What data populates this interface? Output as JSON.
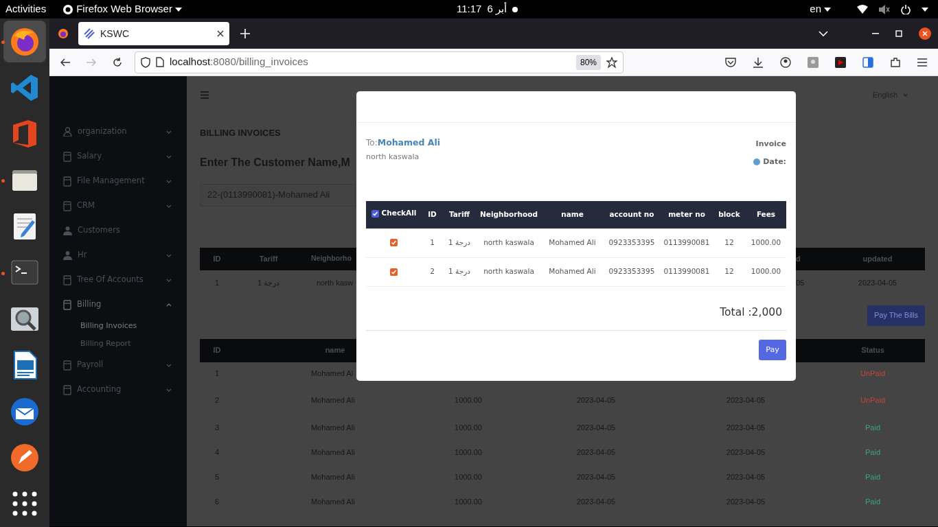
{
  "desktop": {
    "activities": "Activities",
    "app_menu": "Firefox Web Browser",
    "clock": {
      "time": "11:17",
      "date": "أبر 6"
    },
    "keyboard": "en"
  },
  "dock": [
    {
      "kind": "browser",
      "running": true,
      "selected": true
    },
    {
      "kind": "code",
      "running": false,
      "selected": false
    },
    {
      "kind": "office",
      "running": false,
      "selected": false
    },
    {
      "kind": "files",
      "running": true,
      "selected": false
    },
    {
      "kind": "editor",
      "running": false,
      "selected": false
    },
    {
      "kind": "terminal",
      "running": true,
      "selected": false
    },
    {
      "kind": "viewer",
      "running": false,
      "selected": false
    },
    {
      "kind": "writer",
      "running": false,
      "selected": false
    },
    {
      "kind": "mail",
      "running": false,
      "selected": false
    },
    {
      "kind": "api",
      "running": false,
      "selected": false
    },
    {
      "kind": "apps",
      "running": false,
      "selected": false
    }
  ],
  "browser": {
    "tab": {
      "title": "KSWC"
    },
    "url": {
      "host": "localhost",
      "path": ":8080/billing_invoices"
    },
    "zoom": "80%"
  },
  "sidebar": {
    "items": [
      {
        "label": "organization",
        "kind": "menu",
        "expanded": false
      },
      {
        "label": "Salary",
        "kind": "menu",
        "expanded": false
      },
      {
        "label": "File Management",
        "kind": "menu",
        "expanded": false
      },
      {
        "label": "CRM",
        "kind": "menu",
        "expanded": false
      },
      {
        "label": "Customers",
        "kind": "link"
      },
      {
        "label": "Hr",
        "kind": "menu",
        "expanded": false
      },
      {
        "label": "Tree Of Accounts",
        "kind": "menu",
        "expanded": false
      },
      {
        "label": "Billing",
        "kind": "menu",
        "expanded": true,
        "children": [
          {
            "label": "Billing Invoices",
            "selected": true
          },
          {
            "label": "Billing Report",
            "selected": false
          }
        ]
      },
      {
        "label": "Payroll",
        "kind": "menu",
        "expanded": false
      },
      {
        "label": "Accounting",
        "kind": "menu",
        "expanded": false
      }
    ]
  },
  "header": {
    "language": "English"
  },
  "page": {
    "title": "BILLING INVOICES",
    "prompt": "Enter The Customer Name,M",
    "customer": "22-(0113990081)-Mohamed Ali",
    "pay_bills": "Pay The Bills"
  },
  "bills_table": {
    "columns": [
      "ID",
      "Tariff",
      "Neighborho",
      "d",
      "updated"
    ],
    "rows": [
      [
        "1",
        "درجة 1",
        "north kasw",
        "05",
        "2023-04-05"
      ]
    ]
  },
  "invoices_table": {
    "columns": {
      "id": "ID",
      "name": "name",
      "status": "Status"
    },
    "rows": [
      {
        "id": "1",
        "name": "Mohamed Al",
        "status": "UnPaid",
        "paid": false
      },
      {
        "id": "2",
        "name": "Mohamed Ali",
        "fees": "1000.00",
        "created": "2023-04-05",
        "updated": "2023-04-05",
        "status": "UnPaid",
        "paid": false
      },
      {
        "id": "3",
        "name": "Mohamed Ali",
        "fees": "1000.00",
        "created": "2023-04-05",
        "updated": "2023-04-05",
        "status": "Paid",
        "paid": true
      },
      {
        "id": "4",
        "name": "Mohamed Ali",
        "fees": "1000.00",
        "created": "2023-04-05",
        "updated": "2023-04-05",
        "status": "Paid",
        "paid": true
      },
      {
        "id": "5",
        "name": "Mohamed Ali",
        "fees": "1000.00",
        "created": "2023-04-05",
        "updated": "2023-04-05",
        "status": "Paid",
        "paid": true
      },
      {
        "id": "6",
        "name": "Mohamed Ali",
        "fees": "1000.00",
        "created": "2023-04-05",
        "updated": "2023-04-05",
        "status": "Paid",
        "paid": true
      }
    ]
  },
  "modal": {
    "to_label": "To:",
    "customer": "Mohamed Ali",
    "address": "north kaswala",
    "invoice_label": "Invoice",
    "date_label": "Date:",
    "check_all": {
      "label": "CheckAll",
      "checked": true
    },
    "columns": [
      "ID",
      "Tariff",
      "Neighborhood",
      "name",
      "account no",
      "meter no",
      "block",
      "Fees"
    ],
    "rows": [
      {
        "checked": true,
        "cells": [
          "1",
          "درجة 1",
          "north kaswala",
          "Mohamed Ali",
          "0923353395",
          "0113990081",
          "12",
          "1000.00"
        ]
      },
      {
        "checked": true,
        "cells": [
          "2",
          "درجة 1",
          "north kaswala",
          "Mohamed Ali",
          "0923353395",
          "0113990081",
          "12",
          "1000.00"
        ]
      }
    ],
    "total": "Total :2,000",
    "pay": "Pay"
  }
}
